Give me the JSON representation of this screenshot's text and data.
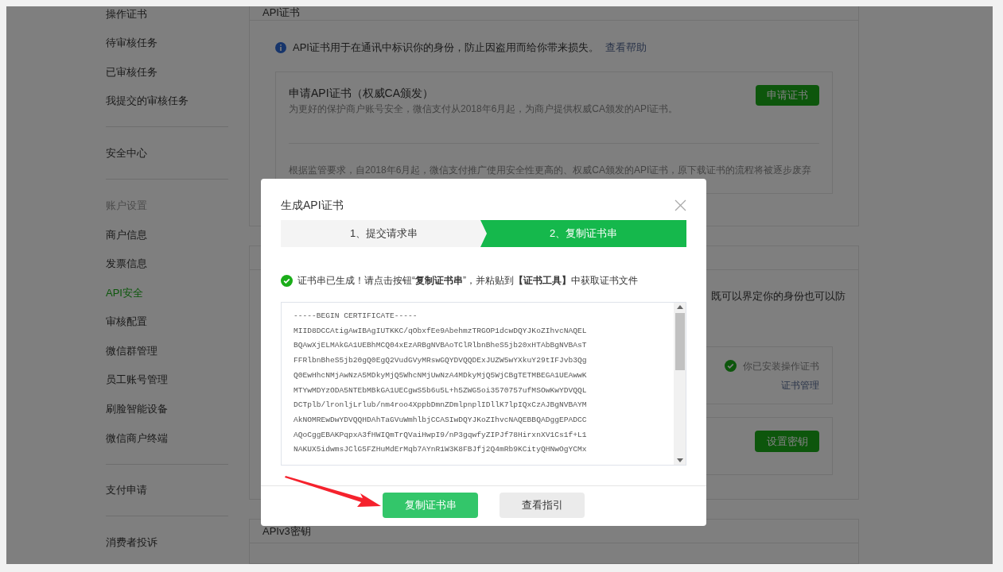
{
  "sidebar": {
    "groups": [
      {
        "items": [
          {
            "label": "操作证书",
            "selected": false
          },
          {
            "label": "待审核任务",
            "selected": false
          },
          {
            "label": "已审核任务",
            "selected": false
          },
          {
            "label": "我提交的审核任务",
            "selected": false
          }
        ]
      },
      {
        "items": [
          {
            "label": "安全中心",
            "selected": false
          }
        ]
      },
      {
        "label": "账户设置",
        "items": [
          {
            "label": "商户信息",
            "selected": false
          },
          {
            "label": "发票信息",
            "selected": false
          },
          {
            "label": "API安全",
            "selected": true
          },
          {
            "label": "审核配置",
            "selected": false
          },
          {
            "label": "微信群管理",
            "selected": false
          },
          {
            "label": "员工账号管理",
            "selected": false
          },
          {
            "label": "刷脸智能设备",
            "selected": false
          },
          {
            "label": "微信商户终端",
            "selected": false
          }
        ]
      },
      {
        "items": [
          {
            "label": "支付申请",
            "selected": false
          }
        ]
      },
      {
        "items": [
          {
            "label": "消费者投诉",
            "selected": false
          }
        ]
      }
    ]
  },
  "api_cert_section": {
    "title": "API证书",
    "info": "API证书用于在通讯中标识你的身份，防止因盗用而给你带来损失。",
    "help_link": "查看帮助",
    "card": {
      "title": "申请API证书（权威CA颁发）",
      "description": "为更好的保护商户账号安全，微信支付从2018年6月起，为商户提供权威CA颁发的API证书。",
      "button": "申请证书",
      "note": "根据监管要求，自2018年6月起，微信支付推广使用安全性更高的、权威CA颁发的API证书，原下载证书的流程将被逐步废弃"
    }
  },
  "second_section": {
    "text_fragment": "既可以界定你的身份也可以防",
    "installed_status": "你已安装操作证书",
    "manage_link": "证书管理",
    "key_button": "设置密钥"
  },
  "third_section": {
    "title": "APIv3密钥"
  },
  "dialog": {
    "title": "生成API证书",
    "steps": [
      {
        "label": "1、提交请求串",
        "selected": false
      },
      {
        "label": "2、复制证书串",
        "selected": true
      }
    ],
    "message": "证书串已生成！请点击按钮“**复制证书串**”，并粘贴到**【证书工具】**中获取证书文件",
    "certificate_lines": [
      "-----BEGIN CERTIFICATE-----",
      "MIID8DCCAtigAwIBAgIUTKKC/qObxfEe9AbehmzTRGOP1dcwDQYJKoZIhvcNAQEL",
      "BQAwXjELMAkGA1UEBhMCQ04xEzARBgNVBAoTClRlbnBheS5jb20xHTAbBgNVBAsT",
      "FFRlbnBheS5jb20gQ0EgQ2VudGVyMRswGQYDVQQDExJUZW5wYXkuY29tIFJvb3Qg",
      "Q0EwHhcNMjAwNzA5MDkyMjQ5WhcNMjUwNzA4MDkyMjQ5WjCBgTETMBEGA1UEAwwK",
      "MTYwMDYzODA5NTEbMBkGA1UECgwS5b6u5L+h5ZWG5oi3570757ufMSOwKwYDVQQL",
      "DCTplb/lronljLrlub/nm4roo4XppbDmnZDmlpnplIDllK7lpIQxCzAJBgNVBAYM",
      "AkNOMREwDwYDVQQHDAhTaGVuWmhlbjCCASIwDQYJKoZIhvcNAQEBBQADggEPADCC",
      "AQoCggEBAKPqpxA3fHWIQmTrQVaiHwpI9/nP3gqwfyZIPJf78HirxnXV1Cs1f+L1",
      "NAKUX5idwmsJClG5FZHuMdErMqb7AYnR1W3K8FBJfj2Q4mRb9KCityQHNwOgYCMx"
    ],
    "buttons": [
      {
        "label": "复制证书串",
        "kind": "primary"
      },
      {
        "label": "查看指引",
        "kind": "secondary"
      }
    ]
  }
}
